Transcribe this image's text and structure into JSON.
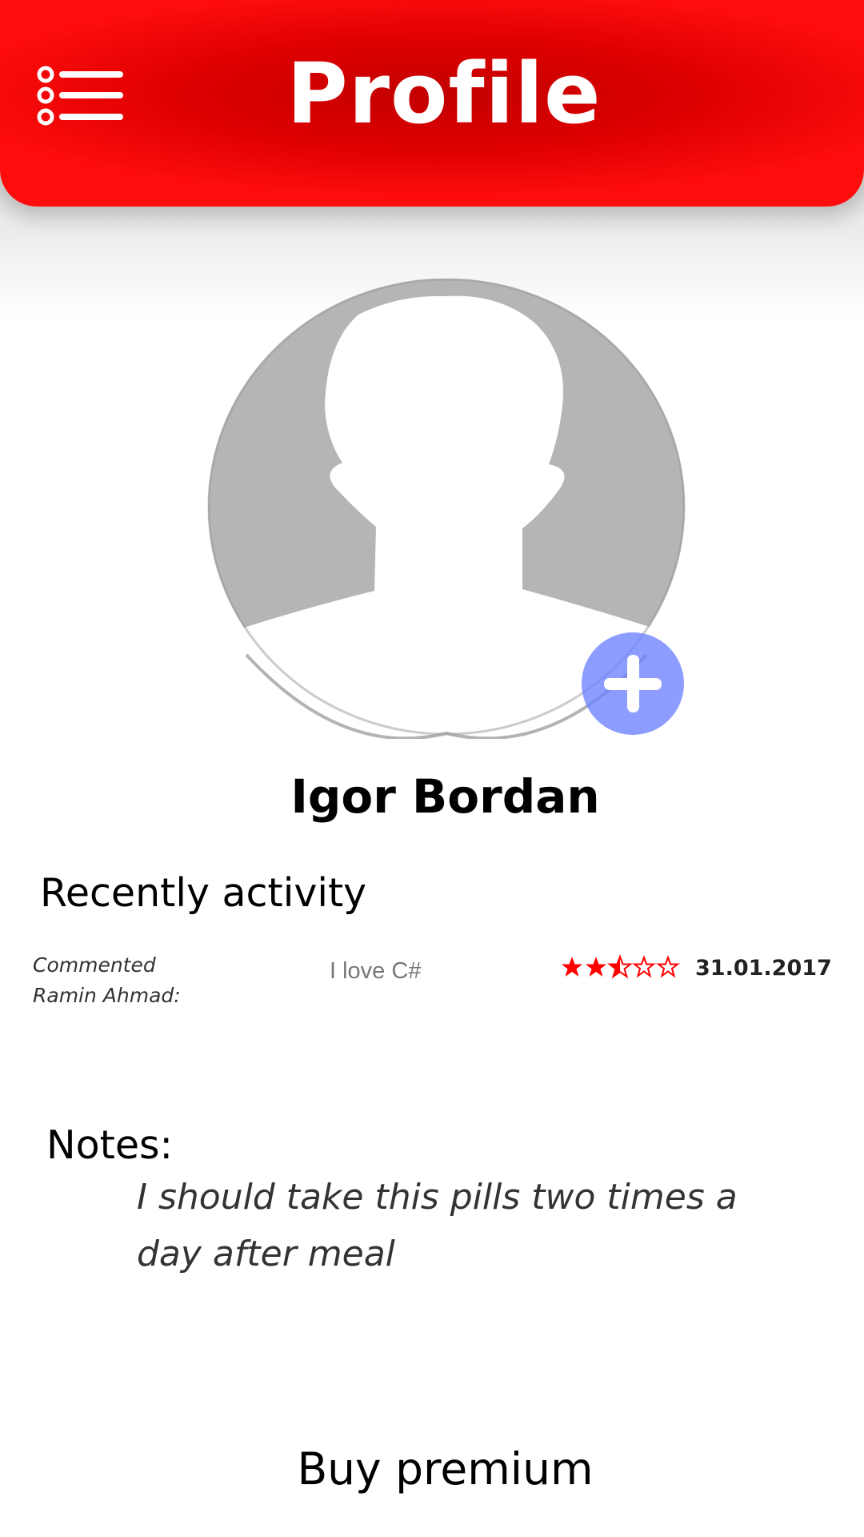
{
  "header": {
    "title": "Profile",
    "background_color": "#e50000",
    "menu_icon": "list-menu-icon"
  },
  "profile": {
    "avatar_icon": "person-silhouette-icon",
    "add_photo_icon": "plus-icon",
    "add_photo_color": "#7b8cff",
    "name": "Igor Bordan"
  },
  "recent_activity": {
    "heading": "Recently activity",
    "items": [
      {
        "action_line_1": "Commented",
        "action_line_2": "Ramin Ahmad:",
        "comment": "I love C#",
        "rating": 2.5,
        "rating_max": 5,
        "rating_color": "#ff0000",
        "date": "31.01.2017"
      }
    ]
  },
  "notes": {
    "heading": "Notes:",
    "text": "I should take this pills two times a day after meal"
  },
  "footer": {
    "premium_label": "Buy premium"
  }
}
